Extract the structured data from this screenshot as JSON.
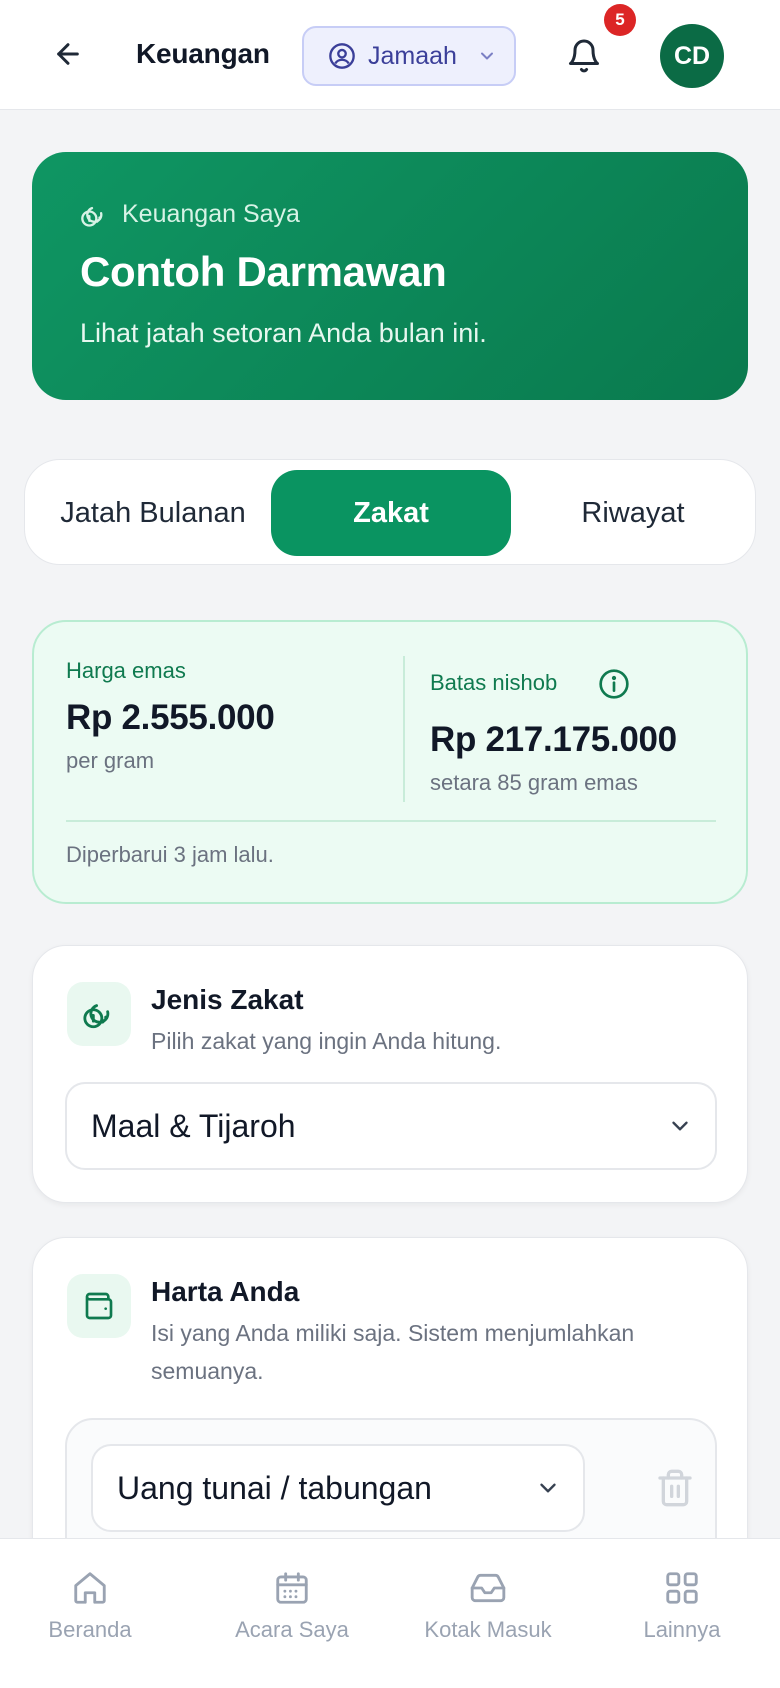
{
  "header": {
    "title": "Keuangan",
    "role": "Jamaah",
    "notification_count": "5",
    "avatar_initials": "CD"
  },
  "hero": {
    "eyebrow": "Keuangan Saya",
    "name": "Contoh Darmawan",
    "subtitle": "Lihat jatah setoran Anda bulan ini."
  },
  "tabs": [
    {
      "label": "Jatah Bulanan",
      "active": false
    },
    {
      "label": "Zakat",
      "active": true
    },
    {
      "label": "Riwayat",
      "active": false
    }
  ],
  "gold": {
    "price_label": "Harga emas",
    "price_value": "Rp 2.555.000",
    "price_unit": "per gram",
    "nishob_label": "Batas nishob",
    "nishob_value": "Rp 217.175.000",
    "nishob_note": "setara 85 gram emas",
    "updated": "Diperbarui 3 jam lalu."
  },
  "zakat_type": {
    "title": "Jenis Zakat",
    "subtitle": "Pilih zakat yang ingin Anda hitung.",
    "selected": "Maal & Tijaroh"
  },
  "assets": {
    "title": "Harta Anda",
    "subtitle": "Isi yang Anda miliki saja. Sistem menjumlahkan semuanya.",
    "item_selected": "Uang tunai / tabungan"
  },
  "bottom_nav": [
    {
      "label": "Beranda",
      "icon": "home-icon"
    },
    {
      "label": "Acara Saya",
      "icon": "calendar-icon"
    },
    {
      "label": "Kotak Masuk",
      "icon": "inbox-icon"
    },
    {
      "label": "Lainnya",
      "icon": "grid-icon"
    }
  ],
  "colors": {
    "primary": "#0a9461",
    "hero_start": "#0f9663",
    "hero_end": "#0a7a4e",
    "badge": "#dc2626",
    "role_pill_bg": "#eef0fd"
  }
}
